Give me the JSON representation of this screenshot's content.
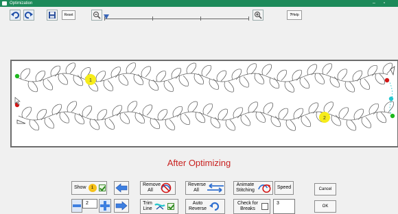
{
  "window": {
    "title": "Optimization"
  },
  "toolbar": {
    "reset_label": "Reset",
    "help_label": "Help"
  },
  "canvas": {
    "marker_1_label": "1",
    "marker_2_label": "2"
  },
  "status": {
    "text": "After Optimizing"
  },
  "controls": {
    "show_label": "Show",
    "show_badge": "1",
    "remove_all_label": "Remove All",
    "reverse_all_label": "Reverse All",
    "animate_label": "Animate Stitching",
    "speed_label": "Speed",
    "cancel_label": "Cancel",
    "ok_label": "OK",
    "stepper_value": "2",
    "trim_line_label": "Trim Line",
    "auto_reverse_label": "Auto Reverse",
    "check_breaks_label": "Check for Breaks",
    "breaks_value": "3"
  },
  "colors": {
    "accent_red": "#c8201e",
    "titlebar": "#1d8a5a",
    "arrow_blue": "#2f6fd0",
    "marker_yellow": "#f6ec1a"
  }
}
